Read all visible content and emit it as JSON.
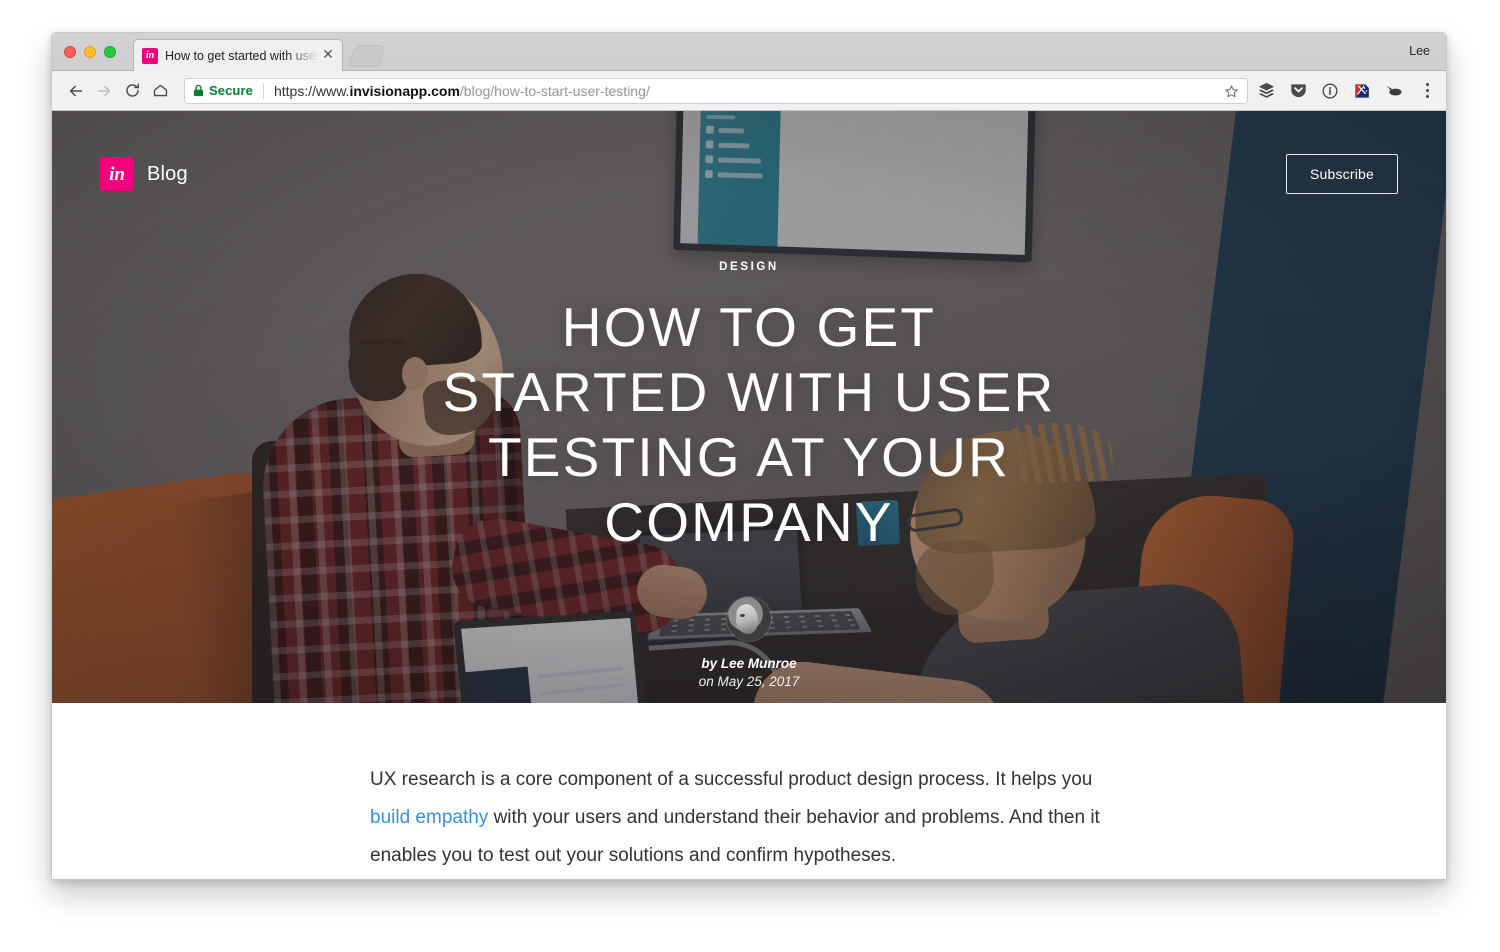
{
  "browser": {
    "tab": {
      "title": "How to get started with user te",
      "favicon_label": "in",
      "close_label": "✕"
    },
    "profile_name": "Lee",
    "omnibox": {
      "secure_label": "Secure",
      "url_scheme": "https://www.",
      "url_host": "invisionapp.com",
      "url_path": "/blog/how-to-start-user-testing/",
      "full_url": "https://www.invisionapp.com/blog/how-to-start-user-testing/"
    },
    "icons": {
      "back": "back-arrow-icon",
      "forward": "forward-arrow-icon",
      "reload": "reload-icon",
      "home": "home-icon",
      "lock": "lock-icon",
      "bookmark": "star-icon",
      "ext1": "layers-icon",
      "ext2": "pocket-shield-icon",
      "ext3": "info-circle-icon",
      "ext4": "colorful-flag-icon",
      "ext5": "dark-blob-icon",
      "menu": "three-dots-menu-icon"
    }
  },
  "site": {
    "brand_logo": "in",
    "brand_name": "Blog",
    "subscribe_label": "Subscribe"
  },
  "hero": {
    "category": "DESIGN",
    "headline": "HOW TO GET STARTED WITH USER TESTING AT YOUR COMPANY",
    "author": "by Lee Munroe",
    "date": "on May 25, 2017",
    "avatar_alt": "author-avatar"
  },
  "article": {
    "paragraph_part1": "UX research is a core component of a successful product design process. It helps you ",
    "link_text": "build empathy",
    "paragraph_part2": " with your users and understand their behavior and problems. And then it enables you to test out your solutions and confirm hypotheses."
  },
  "colors": {
    "brand_pink": "#f2007d",
    "link_blue": "#3b8fd4",
    "secure_green": "#0b7d33",
    "hero_overlay": "rgba(46,42,44,0.36)"
  },
  "monitor_sidebar_rows": [
    {
      "label": "row-1"
    },
    {
      "label": "row-2"
    },
    {
      "label": "row-3"
    },
    {
      "label": "row-4"
    },
    {
      "label": "row-5"
    },
    {
      "label": "row-6"
    },
    {
      "label": "row-7"
    }
  ]
}
